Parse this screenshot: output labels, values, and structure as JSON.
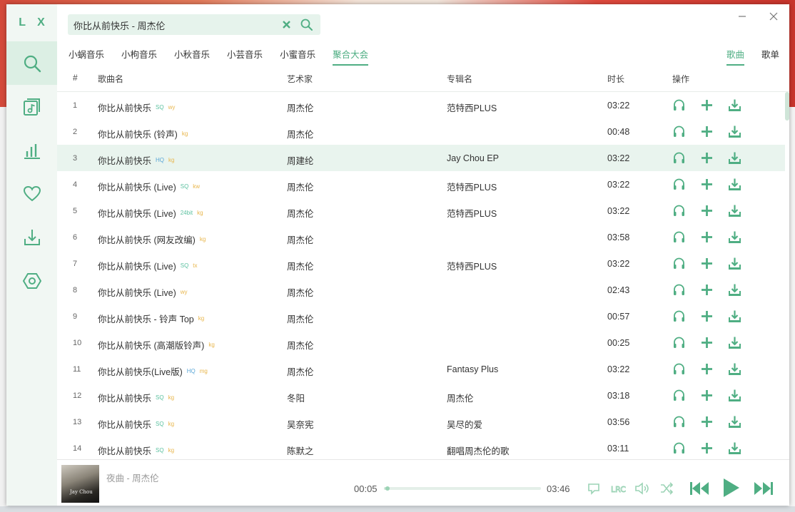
{
  "colors": {
    "accent": "#4fae83",
    "highlight_row": "#e9f4ee",
    "sidebar_bg": "#f1f7f3"
  },
  "app": {
    "logo": "L X"
  },
  "sidebar": {
    "items": [
      {
        "icon": "search-icon",
        "active": true
      },
      {
        "icon": "music-list-icon",
        "active": false
      },
      {
        "icon": "leaderboard-icon",
        "active": false
      },
      {
        "icon": "heart-icon",
        "active": false
      },
      {
        "icon": "download-icon",
        "active": false
      },
      {
        "icon": "settings-icon",
        "active": false
      }
    ]
  },
  "search": {
    "value": "你比从前快乐 - 周杰伦"
  },
  "sources": [
    "小蜗音乐",
    "小枸音乐",
    "小秋音乐",
    "小芸音乐",
    "小蜜音乐",
    "聚合大会"
  ],
  "active_source": "聚合大会",
  "type_tabs": [
    "歌曲",
    "歌单"
  ],
  "active_type": "歌曲",
  "table": {
    "headers": {
      "num": "#",
      "name": "歌曲名",
      "artist": "艺术家",
      "album": "专辑名",
      "duration": "时长",
      "ops": "操作"
    },
    "rows": [
      {
        "num": "1",
        "name": "你比从前快乐",
        "quality": "SQ",
        "source": "wy",
        "artist": "周杰伦",
        "album": "范特西PLUS",
        "duration": "03:22"
      },
      {
        "num": "2",
        "name": "你比从前快乐 (铃声)",
        "quality": "",
        "source": "kg",
        "artist": "周杰伦",
        "album": "",
        "duration": "00:48"
      },
      {
        "num": "3",
        "name": "你比从前快乐",
        "quality": "HQ",
        "source": "kg",
        "artist": "周建纶",
        "album": "Jay Chou EP",
        "duration": "03:22"
      },
      {
        "num": "4",
        "name": "你比从前快乐 (Live)",
        "quality": "SQ",
        "source": "kw",
        "artist": "周杰伦",
        "album": "范特西PLUS",
        "duration": "03:22"
      },
      {
        "num": "5",
        "name": "你比从前快乐 (Live)",
        "quality": "24bit",
        "source": "kg",
        "artist": "周杰伦",
        "album": "范特西PLUS",
        "duration": "03:22"
      },
      {
        "num": "6",
        "name": "你比从前快乐 (网友改编)",
        "quality": "",
        "source": "kg",
        "artist": "周杰伦",
        "album": "",
        "duration": "03:58"
      },
      {
        "num": "7",
        "name": "你比从前快乐 (Live)",
        "quality": "SQ",
        "source": "tx",
        "artist": "周杰伦",
        "album": "范特西PLUS",
        "duration": "03:22"
      },
      {
        "num": "8",
        "name": "你比从前快乐 (Live)",
        "quality": "",
        "source": "wy",
        "artist": "周杰伦",
        "album": "",
        "duration": "02:43"
      },
      {
        "num": "9",
        "name": "你比从前快乐 - 铃声 Top",
        "quality": "",
        "source": "kg",
        "artist": "周杰伦",
        "album": "",
        "duration": "00:57"
      },
      {
        "num": "10",
        "name": "你比从前快乐 (高潮版铃声)",
        "quality": "",
        "source": "kg",
        "artist": "周杰伦",
        "album": "",
        "duration": "00:25"
      },
      {
        "num": "11",
        "name": "你比从前快乐(Live版)",
        "quality": "HQ",
        "source": "mg",
        "artist": "周杰伦",
        "album": "Fantasy Plus",
        "duration": "03:22"
      },
      {
        "num": "12",
        "name": "你比从前快乐",
        "quality": "SQ",
        "source": "kg",
        "artist": "冬阳",
        "album": "周杰伦",
        "duration": "03:18"
      },
      {
        "num": "13",
        "name": "你比从前快乐",
        "quality": "SQ",
        "source": "kg",
        "artist": "吴奈宪",
        "album": "吴尽的爱",
        "duration": "03:56"
      },
      {
        "num": "14",
        "name": "你比从前快乐",
        "quality": "SQ",
        "source": "kg",
        "artist": "陈默之",
        "album": "翻唱周杰伦的歌",
        "duration": "03:11"
      }
    ]
  },
  "tag_colors": {
    "SQ": "#5cc1a0",
    "HQ": "#5aa6d6",
    "24bit": "#5cc1a0",
    "wy": "#e8b64c",
    "kg": "#e8b64c",
    "kw": "#e8b64c",
    "tx": "#e8b64c",
    "mg": "#e8b64c"
  },
  "player": {
    "now_playing": "夜曲 - 周杰伦",
    "cover_text": "Jay Chou",
    "current_time": "00:05",
    "total_time": "03:46",
    "progress": 0.022
  }
}
